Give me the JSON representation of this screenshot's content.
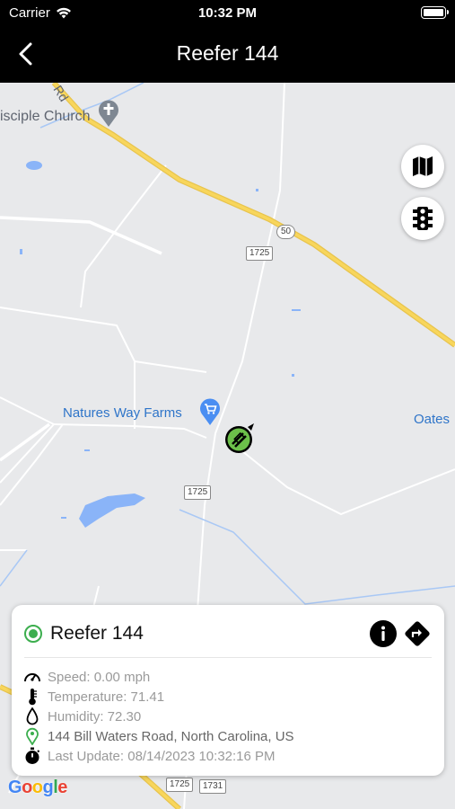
{
  "status_bar": {
    "carrier": "Carrier",
    "time": "10:32 PM"
  },
  "nav": {
    "title": "Reefer 144"
  },
  "map": {
    "labels": {
      "church": "isciple Church",
      "farms": "Natures Way Farms",
      "oates": "Oates",
      "road": "Rd"
    },
    "shields": {
      "us50": "50",
      "sr1725_a": "1725",
      "sr1725_b": "1725",
      "sr1725_c": "1725",
      "sr1731": "1731"
    },
    "buttons": {
      "map_type_icon": "map-icon",
      "traffic_icon": "traffic-light-icon"
    },
    "logo": "Google"
  },
  "card": {
    "name": "Reefer 144",
    "status_color": "#3cae4e",
    "speed": "Speed: 0.00 mph",
    "temperature": "Temperature: 71.41",
    "humidity": "Humidity: 72.30",
    "address": "144 Bill Waters Road, North Carolina, US",
    "last_update": "Last Update: 08/14/2023 10:32:16 PM"
  },
  "colors": {
    "highway": "#f5c542",
    "water": "#8ab4f8",
    "accent_green": "#3cae4e",
    "poi_blue": "#2f75c9"
  }
}
